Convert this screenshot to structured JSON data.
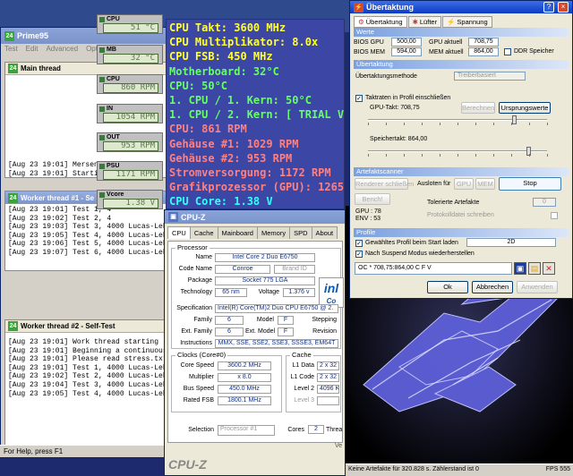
{
  "prime95": {
    "title": "Prime95",
    "menu": [
      "Test",
      "Edit",
      "Advanced",
      "Options"
    ],
    "main_thread": {
      "title": "Main thread",
      "log": [
        "[Aug 23 19:01] Mersenne",
        "[Aug 23 19:01] Starting w"
      ]
    },
    "worker1": {
      "title": "Worker thread #1 - Se",
      "log": [
        "[Aug 23 19:01] Test 1, 4",
        "[Aug 23 19:02] Test 2, 4",
        "[Aug 23 19:03] Test 3, 4000 Lucas-Lehme",
        "[Aug 23 19:05] Test 4, 4000 Lucas-Lehme",
        "[Aug 23 19:06] Test 5, 4000 Lucas-Lehme",
        "[Aug 23 19:07] Test 6, 4000 Lucas-Lehme"
      ]
    },
    "worker2": {
      "title": "Worker thread #2 - Self-Test",
      "log": [
        "[Aug 23 19:01] Work thread starting",
        "[Aug 23 19:01] Beginning a continuous se",
        "[Aug 23 19:01] Please read stress.txt.  Ch",
        "[Aug 23 19:01] Test 1, 4000 Lucas-Lehme",
        "[Aug 23 19:02] Test 2, 4000 Lucas-Lehme",
        "[Aug 23 19:04] Test 3, 4000 Lucas-Lehme",
        "[Aug 23 19:05] Test 4, 4000 Lucas-Lehme"
      ]
    },
    "status": "For Help, press F1"
  },
  "gadgets": [
    {
      "label": "CPU",
      "value": "51 °C"
    },
    {
      "label": "MB",
      "value": "32 °C"
    },
    {
      "label": "CPU",
      "value": "860 RPM"
    },
    {
      "label": "IN",
      "value": "1054 RPM"
    },
    {
      "label": "OUT",
      "value": "953 RPM"
    },
    {
      "label": "PSU",
      "value": "1171 RPM"
    },
    {
      "label": "Vcore",
      "value": "1.38 V"
    }
  ],
  "osd": {
    "colors": {
      "yellow": "#ffff33",
      "green": "#66ff66",
      "salmon": "#ff8080",
      "cyan": "#33ffff"
    },
    "lines": [
      {
        "text": "CPU Takt: 3600 MHz",
        "color": "#ffff33"
      },
      {
        "text": "CPU Multiplikator: 8.0x",
        "color": "#ffff33"
      },
      {
        "text": "CPU FSB: 450 MHz",
        "color": "#ffff33"
      },
      {
        "text": "Motherboard: 32°C",
        "color": "#66ff66"
      },
      {
        "text": "CPU: 50°C",
        "color": "#66ff66"
      },
      {
        "text": "1. CPU / 1. Kern: 50°C",
        "color": "#66ff66"
      },
      {
        "text": "1. CPU / 2. Kern: [ TRIAL VER",
        "color": "#66ff66"
      },
      {
        "text": "CPU: 861 RPM",
        "color": "#ff8080"
      },
      {
        "text": "Gehäuse #1: 1029 RPM",
        "color": "#ff8080"
      },
      {
        "text": "Gehäuse #2: 953 RPM",
        "color": "#ff8080"
      },
      {
        "text": "Stromversorgung: 1172 RPM",
        "color": "#ff8080"
      },
      {
        "text": "Grafikprozessor (GPU): 1265",
        "color": "#ff8080"
      },
      {
        "text": "CPU Core: 1.38 V",
        "color": "#33ffff"
      }
    ]
  },
  "cpuz": {
    "title": "CPU-Z",
    "tabs": [
      "CPU",
      "Cache",
      "Mainboard",
      "Memory",
      "SPD",
      "About"
    ],
    "processor_group": "Processor",
    "name_label": "Name",
    "name": "Intel Core 2 Duo E6750",
    "codename_label": "Code Name",
    "codename": "Conroe",
    "brandid": "Brand ID",
    "package_label": "Package",
    "package": "Socket 775 LGA",
    "technology_label": "Technology",
    "technology": "65 nm",
    "voltage_label": "Voltage",
    "voltage": "1.376 v",
    "spec_label": "Specification",
    "spec": "Intel(R) Core(TM)2 Duo CPU     E6750  @ 2.",
    "family_label": "Family",
    "family": "6",
    "model_label": "Model",
    "model": "F",
    "stepping_label": "Stepping",
    "extfamily_label": "Ext. Family",
    "extfamily": "6",
    "extmodel_label": "Ext. Model",
    "extmodel": "F",
    "revision_label": "Revision",
    "instructions_label": "Instructions",
    "instructions": "MMX, SSE, SSE2, SSE3, SSSE3, EM64T",
    "clocks_group": "Clocks (Core#0)",
    "corespeed_label": "Core Speed",
    "corespeed": "3600.2 MHz",
    "multiplier_label": "Multiplier",
    "multiplier": "x 8.0",
    "busspeed_label": "Bus Speed",
    "busspeed": "450.0 MHz",
    "ratedfsb_label": "Rated FSB",
    "ratedfsb": "1800.1 MHz",
    "cache_group": "Cache",
    "l1data_label": "L1 Data",
    "l1data": "2 x 32",
    "l1code_label": "L1 Code",
    "l1code": "2 x 32",
    "level2_label": "Level 2",
    "level2": "4096 K",
    "level3_label": "Level 3",
    "selection_label": "Selection",
    "selection": "Processor #1",
    "cores_label": "Cores",
    "cores": "2",
    "threads_label": "Threa",
    "version": "Ve",
    "brand": "CPU-Z",
    "logo": "inl",
    "logo_sub": "Co"
  },
  "oc": {
    "title": "Übertaktung",
    "tabs": [
      "Übertaktung",
      "Lüfter",
      "Spannung"
    ],
    "werte": "Werte",
    "bios_gpu_label": "BIOS GPU",
    "bios_gpu": "500,00",
    "gpu_aktuell_label": "GPU aktuell",
    "gpu_aktuell": "708,75",
    "bios_mem_label": "BIOS MEM",
    "bios_mem": "594,00",
    "mem_aktuell_label": "MEM aktuell",
    "mem_aktuell": "864,00",
    "ddr_label": "DDR Speicher",
    "uebertaktung": "Übertaktung",
    "method_label": "Übertaktungsmethode",
    "method": "Treiberbasiert",
    "include_label": "Taktraten in Profil einschließen",
    "gpu_takt_label": "GPU-Takt: 708,75",
    "berechnen": "Berechnen",
    "ursprung": "Ursprungswerte",
    "gpu_slider_value": 0.82,
    "mem_takt_label": "Speichertakt: 864,00",
    "mem_slider_value": 0.9,
    "scanner": "Artefaktscanner",
    "renderer_label": "Renderer schließen",
    "ausloten_label": "Ausloten für",
    "gpu_btn": "GPU",
    "mem_btn": "MEM",
    "stop_btn": "Stop",
    "bench_btn": "Bench!",
    "tolerated_label": "Tolerierte Artefakte",
    "tolerated": "0",
    "protocol_label": "Protokolldatei schreiben",
    "gpu_temp": "GPU : 78",
    "env_temp": "ENV : 53",
    "profile": "Profile",
    "load_profile_label": "Gewähltes Profil beim Start laden",
    "profile_mode": "2D",
    "restore_label": "Nach Suspend Modus wiederherstellen",
    "profile_select": "OC * 708,75:864,00 C  F V",
    "ok": "Ok",
    "cancel": "Abbrechen",
    "apply": "Anwenden"
  },
  "status_bottom": {
    "text": "Keine Artefakte für 320.828 s. Zählerstand ist 0",
    "fps": "FPS 555"
  }
}
